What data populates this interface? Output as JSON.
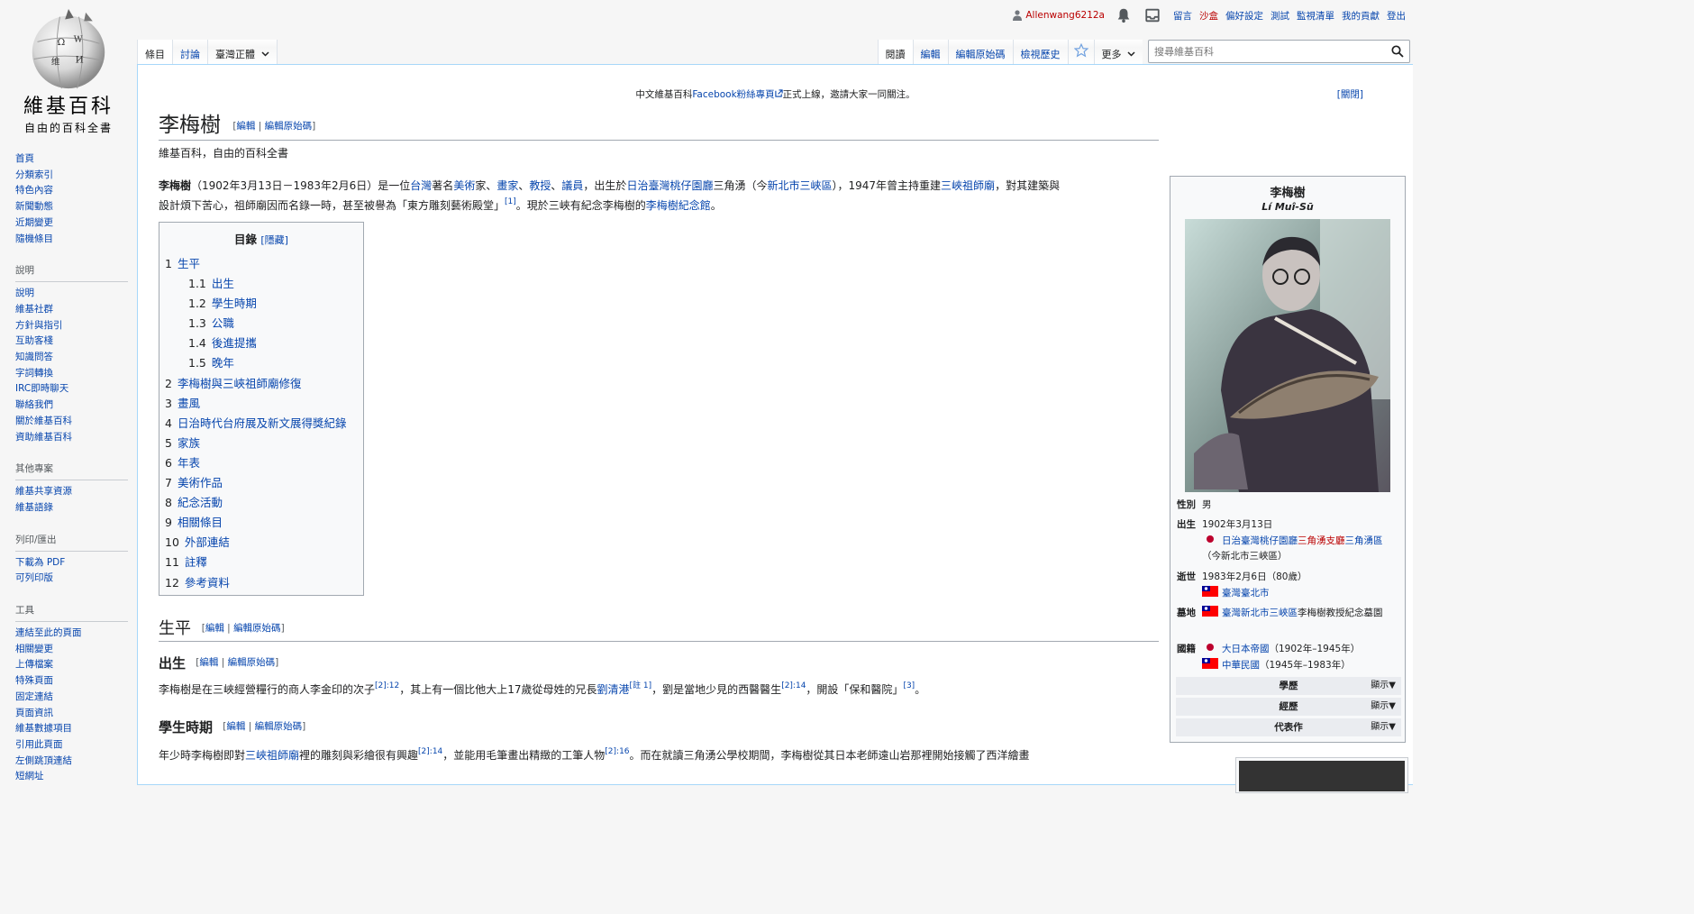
{
  "logo": {
    "name": "維基百科",
    "tagline": "自由的百科全書"
  },
  "sidebar": {
    "navigation": [
      "首頁",
      "分類索引",
      "特色內容",
      "新聞動態",
      "近期變更",
      "隨機條目"
    ],
    "help": {
      "title": "說明",
      "items": [
        "說明",
        "維基社群",
        "方針與指引",
        "互助客棧",
        "知識問答",
        "字詞轉換",
        "IRC即時聊天",
        "聯絡我們",
        "關於維基百科",
        "資助維基百科"
      ]
    },
    "other_projects": {
      "title": "其他專案",
      "items": [
        "維基共享資源",
        "維基語錄"
      ]
    },
    "print": {
      "title": "列印/匯出",
      "items": [
        "下載為 PDF",
        "可列印版"
      ]
    },
    "tools": {
      "title": "工具",
      "items": [
        "連結至此的頁面",
        "相關變更",
        "上傳檔案",
        "特殊頁面",
        "固定連結",
        "頁面資訊",
        "維基數據項目",
        "引用此頁面",
        "左側跳頂連結",
        "短網址"
      ]
    }
  },
  "personal": {
    "username": "Allenwang6212a",
    "links": [
      "留言",
      "沙盒",
      "偏好設定",
      "測試",
      "監視清單",
      "我的貢獻",
      "登出"
    ]
  },
  "tabs": {
    "namespaces": [
      "條目",
      "討論"
    ],
    "variant": "臺灣正體",
    "views": [
      "閱讀",
      "編輯",
      "編輯原始碼",
      "檢視歷史"
    ],
    "more": "更多"
  },
  "search": {
    "placeholder": "搜尋維基百科"
  },
  "sitenotice": {
    "text_pre": "中文維基百科",
    "link": "Facebook粉絲專頁",
    "text_post": "正式上線，邀請大家一同關注。",
    "dismiss": "[關閉]"
  },
  "article": {
    "title": "李梅樹",
    "edit": "編輯",
    "edit_source": "編輯原始碼",
    "site_sub": "維基百科，自由的百科全書",
    "lead": {
      "bold": "李梅樹",
      "t1": "（1902年3月13日－1983年2月6日）是一位",
      "l1": "台灣",
      "t2": "著名",
      "l2": "美術",
      "t3": "家、",
      "l3": "畫家",
      "t4": "、",
      "l4": "教授",
      "t5": "、",
      "l5": "議員",
      "t6": "，出生於",
      "l6": "日治臺灣桃仔園廳",
      "t7": "三角湧（今",
      "l7": "新北市",
      "l8": "三峽區",
      "t8": "），1947年曾主持重建",
      "l9": "三峽祖師廟",
      "t9": "，對其建築與",
      "line2_t1": "設計煩下苦心，祖師廟因而名錄一時，甚至被譽為「東方雕刻藝術殿堂」",
      "ref1": "[1]",
      "line2_t2": "。現於三峽有紀念李梅樹的",
      "l10": "李梅樹紀念館",
      "line2_t3": "。"
    }
  },
  "toc": {
    "title": "目錄",
    "toggle": "[隱藏]",
    "items": [
      {
        "num": "1",
        "label": "生平"
      },
      {
        "num": "1.1",
        "label": "出生"
      },
      {
        "num": "1.2",
        "label": "學生時期"
      },
      {
        "num": "1.3",
        "label": "公職"
      },
      {
        "num": "1.4",
        "label": "後進提攜"
      },
      {
        "num": "1.5",
        "label": "晚年"
      },
      {
        "num": "2",
        "label": "李梅樹與三峽祖師廟修復"
      },
      {
        "num": "3",
        "label": "畫風"
      },
      {
        "num": "4",
        "label": "日治時代台府展及新文展得獎紀錄"
      },
      {
        "num": "5",
        "label": "家族"
      },
      {
        "num": "6",
        "label": "年表"
      },
      {
        "num": "7",
        "label": "美術作品"
      },
      {
        "num": "8",
        "label": "紀念活動"
      },
      {
        "num": "9",
        "label": "相關條目"
      },
      {
        "num": "10",
        "label": "外部連結"
      },
      {
        "num": "11",
        "label": "註釋"
      },
      {
        "num": "12",
        "label": "參考資料"
      }
    ]
  },
  "sections": {
    "bio": "生平",
    "birth": "出生",
    "birth_text": {
      "t1": "李梅樹是在三峽經營糧行的商人李金印的次子",
      "r1": "[2]:12",
      "t2": "，其上有一個比他大上17歲從母姓的兄長",
      "l1": "劉清港",
      "r2": "[註 1]",
      "t3": "，劉是當地少見的西醫醫生",
      "r3": "[2]:14",
      "t4": "，開設「保和醫院」",
      "r4": "[3]",
      "t5": "。"
    },
    "student": "學生時期",
    "student_text": {
      "t1": "年少時李梅樹即對",
      "l1": "三峽祖師廟",
      "t2": "裡的雕刻與彩繪很有興趣",
      "r1": "[2]:14",
      "t3": "，並能用毛筆畫出精緻的工筆人物",
      "r2": "[2]:16",
      "t4": "。而在就讀三角湧公學校期間，李梅樹從其日本老師遠山岩那裡開始接觸了西洋繪畫"
    }
  },
  "infobox": {
    "name": "李梅樹",
    "romanized": "Lí Muî-Sū",
    "gender_label": "性別",
    "gender": "男",
    "birth_label": "出生",
    "birth_date": "1902年3月13日",
    "birth_place_l1": "日治臺灣桃仔園廳",
    "birth_place_l2": "三角湧支廳",
    "birth_place_l3": "三角湧區",
    "birth_place_note": "（今新北市三峽區）",
    "death_label": "逝世",
    "death_date": "1983年2月6日（80歲）",
    "death_place": "臺灣臺北市",
    "grave_label": "墓地",
    "grave_link": "臺灣新北市三峽區",
    "grave_text": "李梅樹教授紀念墓園",
    "nationality_label": "國籍",
    "nat1": "大日本帝國",
    "nat1_years": "（1902年–1945年）",
    "nat2": "中華民國",
    "nat2_years": "（1945年–1983年）",
    "collapsibles": [
      "學歷",
      "經歷",
      "代表作"
    ],
    "show": "顯示▼"
  },
  "colors": {
    "link": "#0645ad",
    "redlink": "#ba0000",
    "border": "#a7d7f9"
  }
}
